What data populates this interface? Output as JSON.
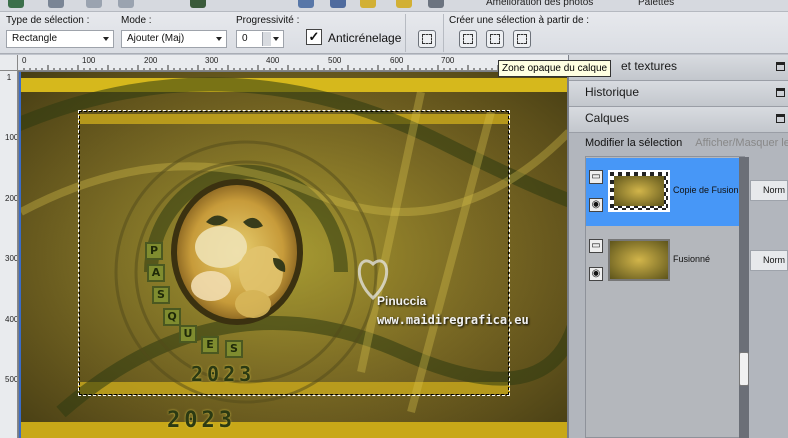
{
  "topbar": {
    "partial_text_1": "Amélioration des photos",
    "partial_text_2": "Palettes"
  },
  "options": {
    "selection_type": {
      "label": "Type de sélection :",
      "value": "Rectangle"
    },
    "mode": {
      "label": "Mode :",
      "value": "Ajouter (Maj)"
    },
    "feather": {
      "label": "Progressivité :",
      "value": "0"
    },
    "antialias": {
      "label": "Anticrénelage",
      "checked": true
    },
    "create_from": {
      "label": "Créer une sélection à partir de :"
    }
  },
  "rulers": {
    "horizontal": [
      "0",
      "100",
      "200",
      "300",
      "400",
      "500",
      "600",
      "700"
    ],
    "vertical": [
      "1",
      "100",
      "200",
      "300",
      "400",
      "500"
    ]
  },
  "canvas": {
    "year_text": "2023",
    "tile_letters": [
      "P",
      "A",
      "S",
      "Q",
      "U",
      "E",
      "S"
    ],
    "watermark_name": "Pinuccia",
    "watermark_url": "www.maidiregrafica.eu"
  },
  "tooltip": "Zone opaque du calque",
  "panels": {
    "textures": "et textures",
    "history": "Historique",
    "layers": "Calques",
    "modify_selection": "Modifier la sélection",
    "show_hide": "Afficher/Masquer les"
  },
  "layers": [
    {
      "name": "Copie de Fusionn",
      "blend": "Norm",
      "selected": true
    },
    {
      "name": "Fusionné",
      "blend": "Norm",
      "selected": false
    }
  ]
}
